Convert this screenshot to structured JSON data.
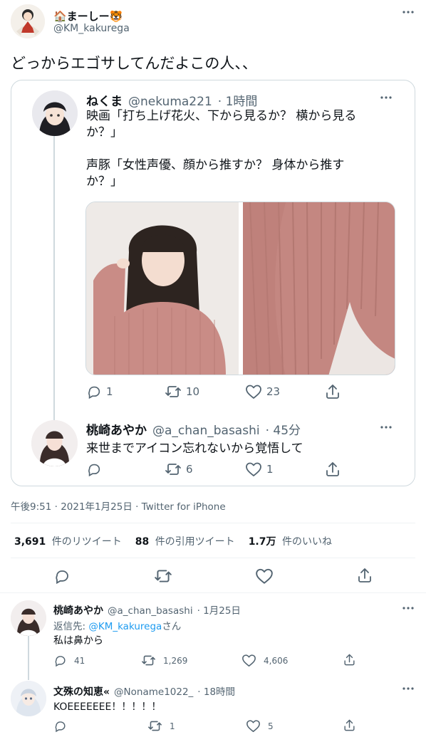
{
  "main_tweet": {
    "display_name": "🏠まーしー🐯",
    "handle": "@KM_kakurega",
    "text": "どっからエゴサしてんだよこの人、、",
    "timestamp": "午後9:51 · 2021年1月25日 · Twitter for iPhone",
    "stats": {
      "retweets_count": "3,691",
      "retweets_label": "件のリツイート",
      "quotes_count": "88",
      "quotes_label": "件の引用ツイート",
      "likes_count": "1.7万",
      "likes_label": "件のいいね"
    }
  },
  "quoted_thread": {
    "first": {
      "display_name": "ねくま",
      "handle": "@nekuma221",
      "time": "· 1時間",
      "text_line1": "映画「打ち上げ花火、下から見るか？ 横から見る",
      "text_line2": "か？」",
      "text_line3": "声豚「女性声優、顔から推すか？ 身体から推す",
      "text_line4": "か？」",
      "replies": "1",
      "retweets": "10",
      "likes": "23"
    },
    "second": {
      "display_name": "桃崎あやか",
      "handle": "@a_chan_basashi",
      "time": "· 45分",
      "text": "来世までアイコン忘れないから覚悟して",
      "replies": "",
      "retweets": "6",
      "likes": "1"
    }
  },
  "replies": [
    {
      "display_name": "桃崎あやか",
      "handle": "@a_chan_basashi",
      "time": "· 1月25日",
      "reply_to_prefix": "返信先: ",
      "reply_to_handle": "@KM_kakurega",
      "reply_to_suffix": "さん",
      "text": "私は鼻から",
      "replies": "41",
      "retweets": "1,269",
      "likes": "4,606"
    },
    {
      "display_name": "文殊の知恵«",
      "handle": "@Noname1022_",
      "time": "· 18時間",
      "text": "KOEEEEEEE！！！！！",
      "replies": "",
      "retweets": "1",
      "likes": "5"
    }
  ],
  "colors": {
    "text": "#0f1419",
    "secondary": "#536471",
    "link": "#1d9bf0",
    "border": "#cfd9de",
    "divider": "#eff3f4",
    "sweater": "#c98c86"
  },
  "icons": [
    "more-icon",
    "reply-icon",
    "retweet-icon",
    "like-icon",
    "share-icon"
  ]
}
